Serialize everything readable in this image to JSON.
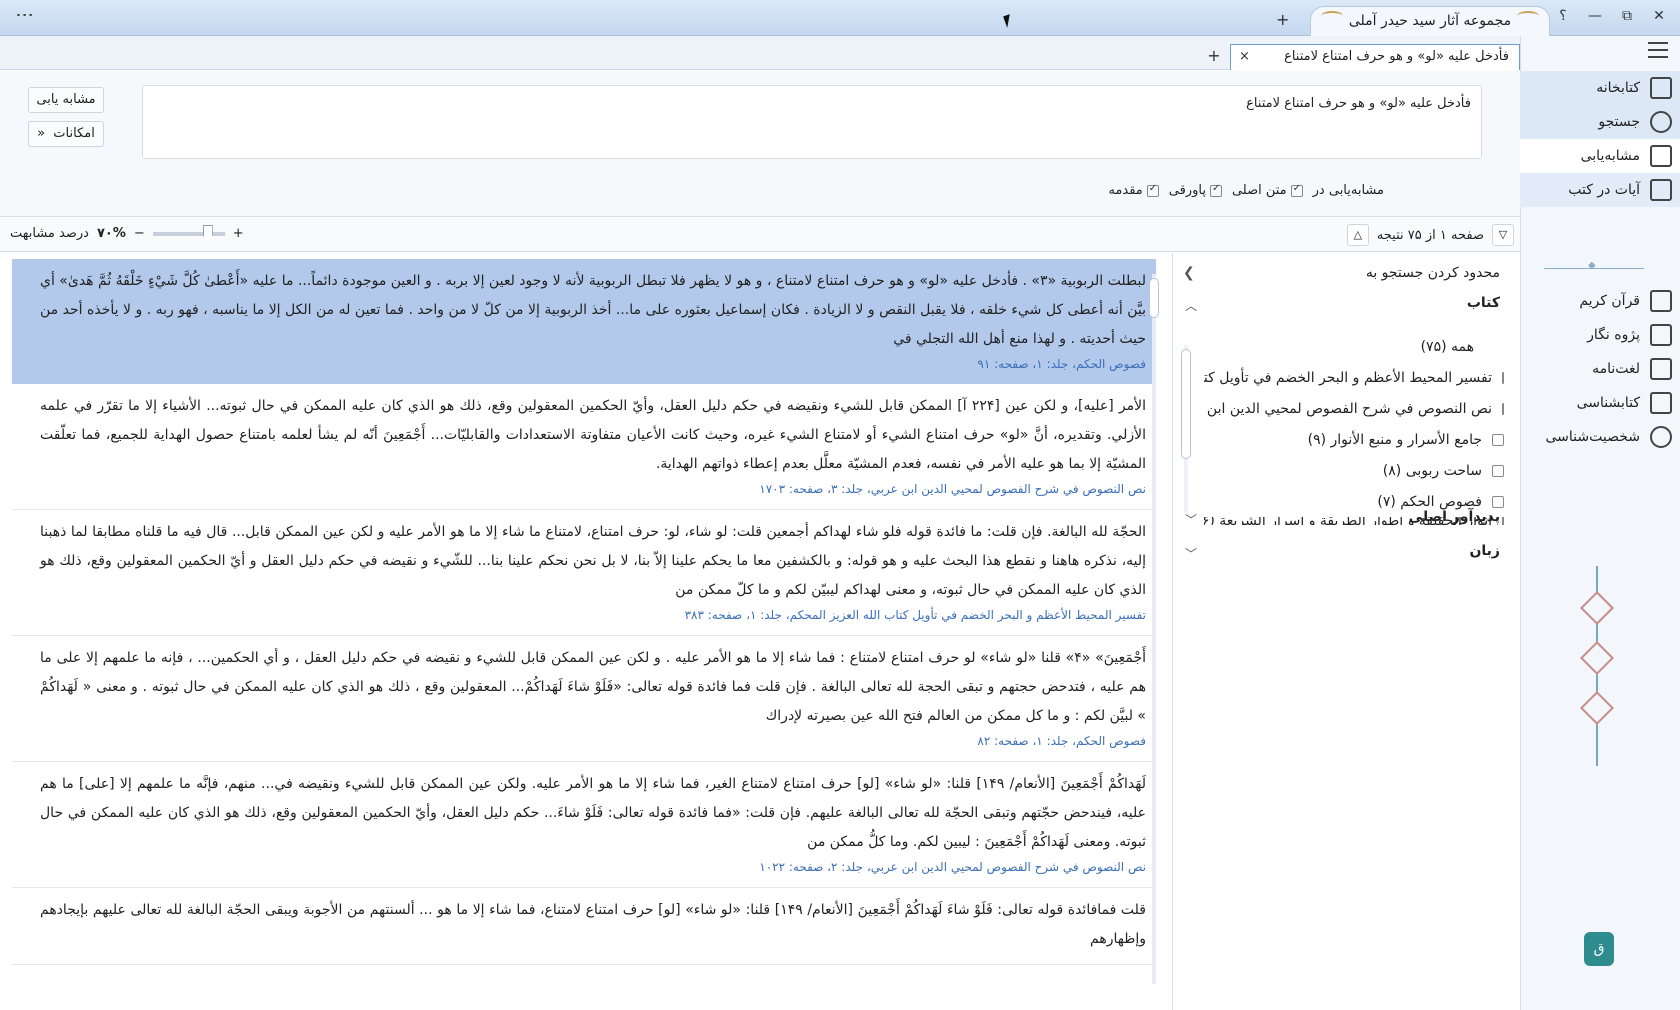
{
  "app": {
    "window_tab_title": "مجموعه آثار سید حیدر آملی",
    "help": "؟",
    "new_tab": "+",
    "minimize": "—",
    "restore": "⧉",
    "close": "✕",
    "menu": "⋮"
  },
  "doc_tab": {
    "title": "فأدخل علیه «لو» و هو حرف امتناع لامتناع",
    "close": "×",
    "add": "+"
  },
  "search": {
    "query": "فأدخل علیه «لو» و هو حرف امتناع لامتناع",
    "similar_button": "مشابه یابی",
    "options_button": "امکانات",
    "options_label": "مشابه‌یابی در",
    "checkbox_main_text": "متن اصلی",
    "checkbox_footnote": "پاورقی",
    "checkbox_intro": "مقدمه"
  },
  "pager": {
    "status": "صفحه ۱ از ۷۵ نتیجه",
    "similarity_label": "درصد مشابهت",
    "similarity_value": "۷۰%",
    "minus": "−",
    "plus": "+"
  },
  "sidebar": {
    "items": [
      {
        "label": "کتابخانه",
        "icon": "library-icon"
      },
      {
        "label": "جستجو",
        "icon": "search-icon"
      },
      {
        "label": "مشابه‌یابی",
        "icon": "similar-icon"
      },
      {
        "label": "آیات در کتب",
        "icon": "verses-icon"
      }
    ],
    "items2": [
      {
        "label": "قرآن کریم",
        "icon": "quran-icon"
      },
      {
        "label": "پژوه نگار",
        "icon": "notes-icon"
      },
      {
        "label": "لغت‌نامه",
        "icon": "dictionary-icon"
      },
      {
        "label": "کتابشناسی",
        "icon": "bibliography-icon"
      },
      {
        "label": "شخصیت‌شناسی",
        "icon": "person-icon"
      }
    ]
  },
  "filter": {
    "header": "محدود کردن جستجو به",
    "books_section": "کتاب",
    "author_section": "پدیدآور اصلی",
    "language_section": "زبان",
    "all": "همه (۷۵)",
    "books": [
      "تفسیر المحیط الأعظم و البحر الخضم في تأويل كتا...",
      "نص النصوص في شرح الفصوص لمحيي الدين ابن ع...",
      "جامع الأسرار و منبع الأنوار (۹)",
      "ساحت ربوبی (۸)",
      "فصوص الحکم (۷)",
      "أنوار الحقيقة و أطوار الطريقة و أسرار الشريعة (۶)"
    ]
  },
  "results": [
    {
      "text": "لبطلت الربوبية «۳» . فأدخل عليه «لو» و هو حرف امتناع لامتناع ، و هو لا يظهر فلا تبطل الربوبية لأنه لا وجود لعين إلا بربه . و العين موجودة دائماً... ما عليه «أَعْطىٰ كُلَّ شَيْءٍ خَلْقَهُ ثُمَّ هَدىٰ» أي بيَّن أنه أعطى كل شيء خلقه ، فلا يقبل النقص و لا الزيادة . فكان إسماعيل بعثوره على ما... أخذ الربوبية إلا من كلّ لا من واحد . فما تعين له من الكل إلا ما يناسبه ، فهو ربه . و لا يأخذه أحد من حيث أحديته . و لهذا منع أهل الله التجلي في",
      "source": "فصوص الحكم، جلد: ۱، صفحه: ۹۱"
    },
    {
      "text": "الأمر [عليه]، و لكن عين [۲۲۴ آ] الممكن قابل للشيء ونقيضه في حكم دليل العقل، وأيّ الحكمين المعقولين وقع، ذلك هو الذي كان عليه الممكن في حال ثبوته... الأشياء إلا ما تقرّر في علمه الأزلي. وتقديره، أنَّ «لو» حرف امتناع الشيء أو لامتناع الشيء غيره، وحيث كانت الأعيان متفاوتة الاستعدادات والقابليّات... أَجْمَعِينَ أنّه لم يشأ لعلمه بامتناع حصول الهداية للجميع، فما تعلّقت المشيّة إلا بما هو عليه الأمر في نفسه، فعدم المشيّة معلَّل بعدم إعطاء ذواتهم الهداية.",
      "source": "نص النصوص في شرح الفصوص لمحيي الدين ابن عربي، جلد: ۳، صفحه: ۱۷۰۳"
    },
    {
      "text": "الحجّة لله البالغة. فإن قلت: ما فائدة قوله فلو شاء لهداكم أجمعين قلت: لو شاء، لو: حرف امتناع، لامتناع ما شاء إلا ما هو الأمر عليه و لكن عين الممكن قابل... قال فيه ما قلناه مطابقا لما ذهبنا إليه، نذكره هاهنا و نقطع هذا البحث عليه و هو قوله: و بالكشفين معا ما يحكم علينا إلاّ بنا، لا بل نحن نحكم علينا بنا... للشّيء و نقيضه في حكم دليل العقل و أيّ الحكمين المعقولين وقع، ذلك هو الذي كان عليه الممكن في حال ثبوته، و معنى لهداكم ليبيّن لكم و ما كلّ ممكن من",
      "source": "تفسير المحيط الأعظم و البحر الخضم في تأويل كتاب الله العزيز المحكم، جلد: ۱، صفحه: ۳۸۳"
    },
    {
      "text": "أَجْمَعِينَ» «۴» قلنا «لو شاء» لو حرف امتناع لامتناع : فما شاء إلا ما هو الأمر عليه . و لكن عين الممكن قابل للشيء و نقيضه في حكم دليل العقل ، و أي الحكمين... ، فإنه ما علمهم إلا على ما هم عليه ، فتدحض حجتهم و تبقى الحجة لله تعالى البالغة . فإن قلت فما فائدة قوله تعالى: «فَلَوْ شاءَ لَهَداكُمْ... المعقولين وقع ، ذلك هو الذي كان عليه الممكن في حال ثبوته . و معنى « لَهَداكُمْ » لبيَّن لكم : و ما كل ممكن من العالم فتح الله عين بصيرته لإدراك",
      "source": "فصوص الحكم، جلد: ۱، صفحه: ۸۲"
    },
    {
      "text": "لَهَداكُمْ أَجْمَعِينَ [الأنعام/ ۱۴۹] قلنا: «لو شاء» [لو] حرف امتناع لامتناع الغير، فما شاء إلا ما هو الأمر عليه. ولكن عين الممكن قابل للشيء ونقيضه في... منهم، فإنَّه ما علمهم إلا [على] ما هم عليه، فيندحض حجّتهم وتبقى الحجّة لله تعالى البالغة عليهم. فإن قلت: «فما فائدة قوله تعالى: فَلَوْ شاءَ... حكم دليل العقل، وأيّ الحكمين المعقولين وقع، ذلك هو الذي كان عليه الممكن في حال ثبوته. ومعنى لَهَداكُمْ أَجْمَعِينَ : ليبين لكم. وما كلُّ ممكن من",
      "source": "نص النصوص في شرح الفصوص لمحيي الدين ابن عربي، جلد: ۲، صفحه: ۱۰۲۲"
    },
    {
      "text": "قلت فمافائدة قوله تعالى: فَلَوْ شاءَ لَهَداكُمْ أَجْمَعِينَ [الأنعام/ ۱۴۹] قلنا: «لو شاء» [لو] حرف امتناع لامتناع، فما شاء إلا ما هو ... ألسنتهم من الأجوبة ويبقى الحجّة البالغة لله تعالى عليهم بإيجادهم وإظهارهم",
      "source": ""
    }
  ]
}
